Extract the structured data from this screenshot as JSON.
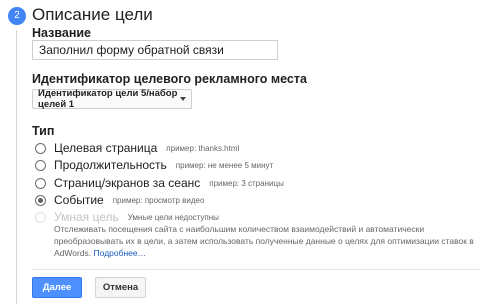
{
  "step": {
    "number": "2",
    "title": "Описание цели"
  },
  "name_section": {
    "label": "Название",
    "value": "Заполнил форму обратной связи"
  },
  "target_section": {
    "label": "Идентификатор целевого рекламного места",
    "selected": "Идентификатор цели 5/набор целей 1"
  },
  "type_section": {
    "label": "Тип",
    "options": [
      {
        "label": "Целевая страница",
        "example": "пример: thanks.html",
        "checked": false,
        "disabled": false
      },
      {
        "label": "Продолжительность",
        "example": "пример: не менее 5 минут",
        "checked": false,
        "disabled": false
      },
      {
        "label": "Страниц/экранов за сеанс",
        "example": "пример: 3 страницы",
        "checked": false,
        "disabled": false
      },
      {
        "label": "Событие",
        "example": "пример: просмотр видео",
        "checked": true,
        "disabled": false
      },
      {
        "label": "Умная цель",
        "example": "Умные цели недоступны",
        "checked": false,
        "disabled": true
      }
    ],
    "smart_description": "Отслеживать посещения сайта с наибольшим количеством взаимодействий и автоматически преобразовывать их в цели, а затем использовать полученные данные о целях для оптимизации ставок в AdWords.",
    "more_link": "Подробнее…"
  },
  "buttons": {
    "next": "Далее",
    "cancel": "Отмена"
  },
  "colors": {
    "accent": "#4285f4",
    "primary_button": "#4d90fe",
    "link": "#1a5cbc"
  }
}
